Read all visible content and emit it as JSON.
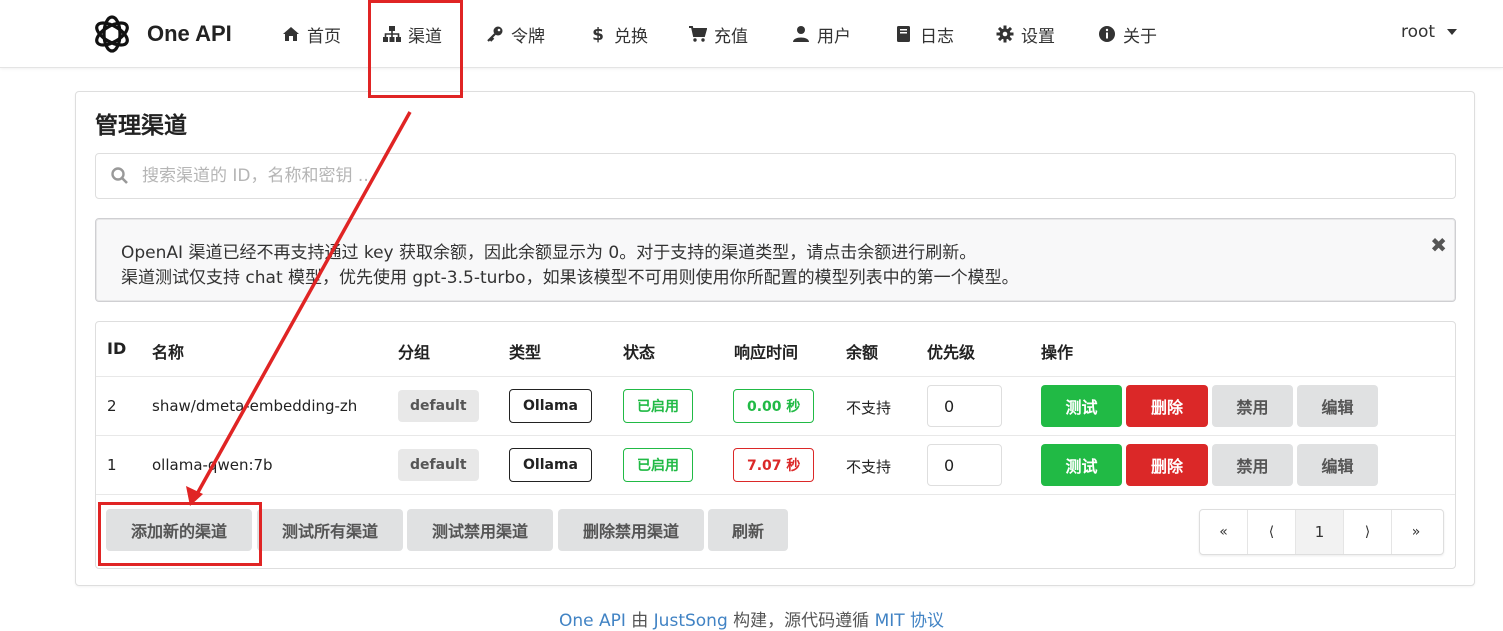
{
  "brand": {
    "name": "One API"
  },
  "nav": [
    {
      "label": "首页",
      "icon": "home-icon"
    },
    {
      "label": "渠道",
      "icon": "sitemap-icon"
    },
    {
      "label": "令牌",
      "icon": "key-icon"
    },
    {
      "label": "兑换",
      "icon": "dollar-icon"
    },
    {
      "label": "充值",
      "icon": "cart-icon"
    },
    {
      "label": "用户",
      "icon": "user-icon"
    },
    {
      "label": "日志",
      "icon": "book-icon"
    },
    {
      "label": "设置",
      "icon": "gear-icon"
    },
    {
      "label": "关于",
      "icon": "info-icon"
    }
  ],
  "user": {
    "name": "root"
  },
  "page": {
    "title": "管理渠道"
  },
  "search": {
    "placeholder": "搜索渠道的 ID，名称和密钥 ..."
  },
  "notice": {
    "line1": "OpenAI 渠道已经不再支持通过 key 获取余额，因此余额显示为 0。对于支持的渠道类型，请点击余额进行刷新。",
    "line2": "渠道测试仅支持 chat 模型，优先使用 gpt-3.5-turbo，如果该模型不可用则使用你所配置的模型列表中的第一个模型。",
    "close": "✖"
  },
  "table": {
    "headers": [
      "ID",
      "名称",
      "分组",
      "类型",
      "状态",
      "响应时间",
      "余额",
      "优先级",
      "操作"
    ],
    "rows": [
      {
        "id": "2",
        "name": "shaw/dmeta-embedding-zh",
        "group": "default",
        "type": "Ollama",
        "status": "已启用",
        "response": "0.00 秒",
        "response_color": "#21ba45",
        "balance": "不支持",
        "priority": "0"
      },
      {
        "id": "1",
        "name": "ollama-qwen:7b",
        "group": "default",
        "type": "Ollama",
        "status": "已启用",
        "response": "7.07 秒",
        "response_color": "#db2828",
        "balance": "不支持",
        "priority": "0"
      }
    ],
    "actions": {
      "test": "测试",
      "delete": "删除",
      "disable": "禁用",
      "edit": "编辑"
    }
  },
  "footer_buttons": {
    "add": "添加新的渠道",
    "test_all": "测试所有渠道",
    "test_disabled": "测试禁用渠道",
    "delete_disabled": "删除禁用渠道",
    "refresh": "刷新"
  },
  "pagination": {
    "first": "«",
    "prev": "⟨",
    "current": "1",
    "next": "⟩",
    "last": "»"
  },
  "footer": {
    "p1": "One API",
    "p2": " 由 ",
    "p3": "JustSong",
    "p4": " 构建，源代码遵循 ",
    "p5": "MIT 协议"
  },
  "colors": {
    "green": "#21ba45",
    "red": "#db2828",
    "annotation": "#e02424"
  }
}
